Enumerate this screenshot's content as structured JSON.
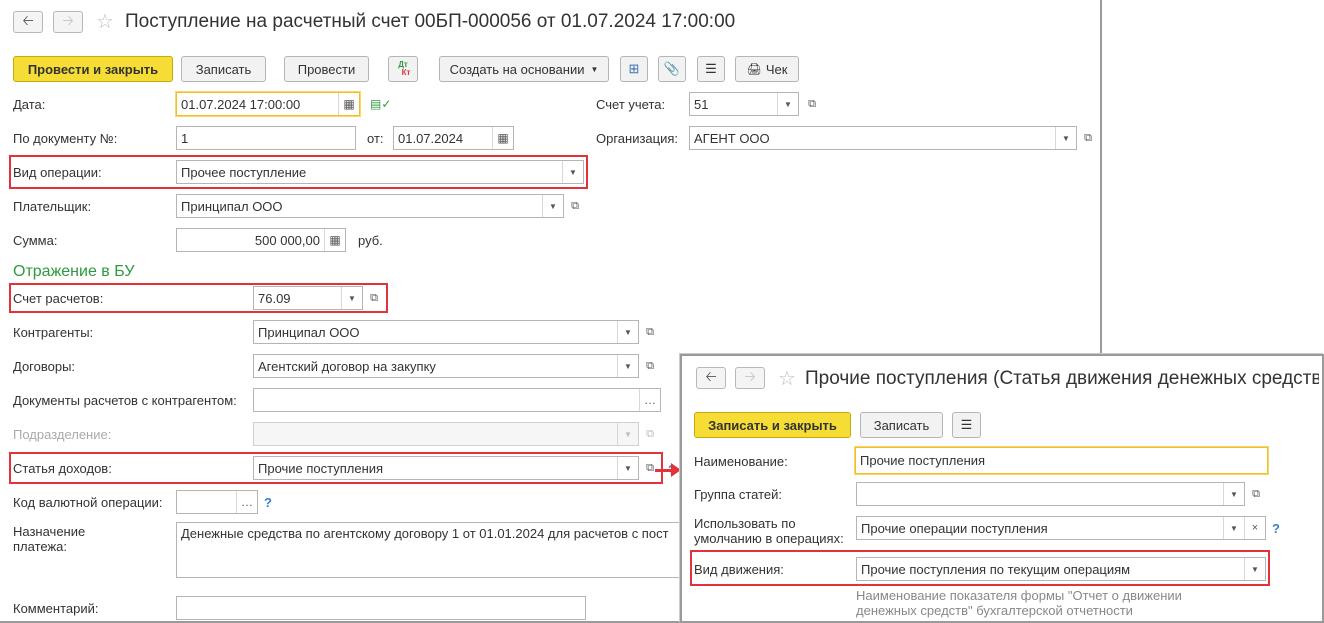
{
  "main": {
    "title": "Поступление на расчетный счет 00БП-000056 от 01.07.2024 17:00:00",
    "toolbar": {
      "post_close": "Провести и закрыть",
      "save": "Записать",
      "post": "Провести",
      "dt_top": "Дт",
      "dt_bottom": "Кт",
      "create_based": "Создать на основании",
      "check": "Чек"
    },
    "date": {
      "label": "Дата:",
      "value": "01.07.2024 17:00:00"
    },
    "doc_number": {
      "label": "По документу №:",
      "value": "1",
      "from_label": "от:",
      "from_value": "01.07.2024"
    },
    "account": {
      "label": "Счет учета:",
      "value": "51"
    },
    "organization": {
      "label": "Организация:",
      "value": "АГЕНТ ООО"
    },
    "operation_type": {
      "label": "Вид операции:",
      "value": "Прочее поступление"
    },
    "payer": {
      "label": "Плательщик:",
      "value": "Принципал ООО"
    },
    "sum": {
      "label": "Сумма:",
      "value": "500 000,00",
      "currency": "руб."
    },
    "section_bu": "Отражение в БУ",
    "settlement_account": {
      "label": "Счет расчетов:",
      "value": "76.09"
    },
    "counterparties": {
      "label": "Контрагенты:",
      "value": "Принципал ООО"
    },
    "contracts": {
      "label": "Договоры:",
      "value": "Агентский договор на закупку"
    },
    "settlement_docs": {
      "label": "Документы расчетов с контрагентом:",
      "value": ""
    },
    "department": {
      "label": "Подразделение:",
      "value": ""
    },
    "income_item": {
      "label": "Статья доходов:",
      "value": "Прочие поступления"
    },
    "currency_op": {
      "label": "Код валютной операции:",
      "value": "",
      "help": "?"
    },
    "purpose": {
      "label_line1": "Назначение",
      "label_line2": "платежа:",
      "value": "Денежные средства по агентскому договору 1 от 01.01.2024 для расчетов с пост"
    },
    "comment": {
      "label": "Комментарий:",
      "value": ""
    }
  },
  "popup": {
    "title": "Прочие поступления (Статья движения денежных средств)",
    "toolbar": {
      "save_close": "Записать и закрыть",
      "save": "Записать"
    },
    "name": {
      "label": "Наименование:",
      "value": "Прочие поступления"
    },
    "group": {
      "label": "Группа статей:",
      "value": ""
    },
    "default_use": {
      "label_line1": "Использовать по",
      "label_line2": "умолчанию в операциях:",
      "value": "Прочие операции поступления",
      "help": "?"
    },
    "movement_type": {
      "label": "Вид движения:",
      "value": "Прочие поступления по текущим операциям"
    },
    "hint_line1": "Наименование показателя формы \"Отчет о движении",
    "hint_line2": "денежных средств\" бухгалтерской отчетности"
  },
  "colors": {
    "accent_yellow": "#f5dd36",
    "highlight_red": "#e2333b",
    "section_green": "#2e9a3f"
  }
}
